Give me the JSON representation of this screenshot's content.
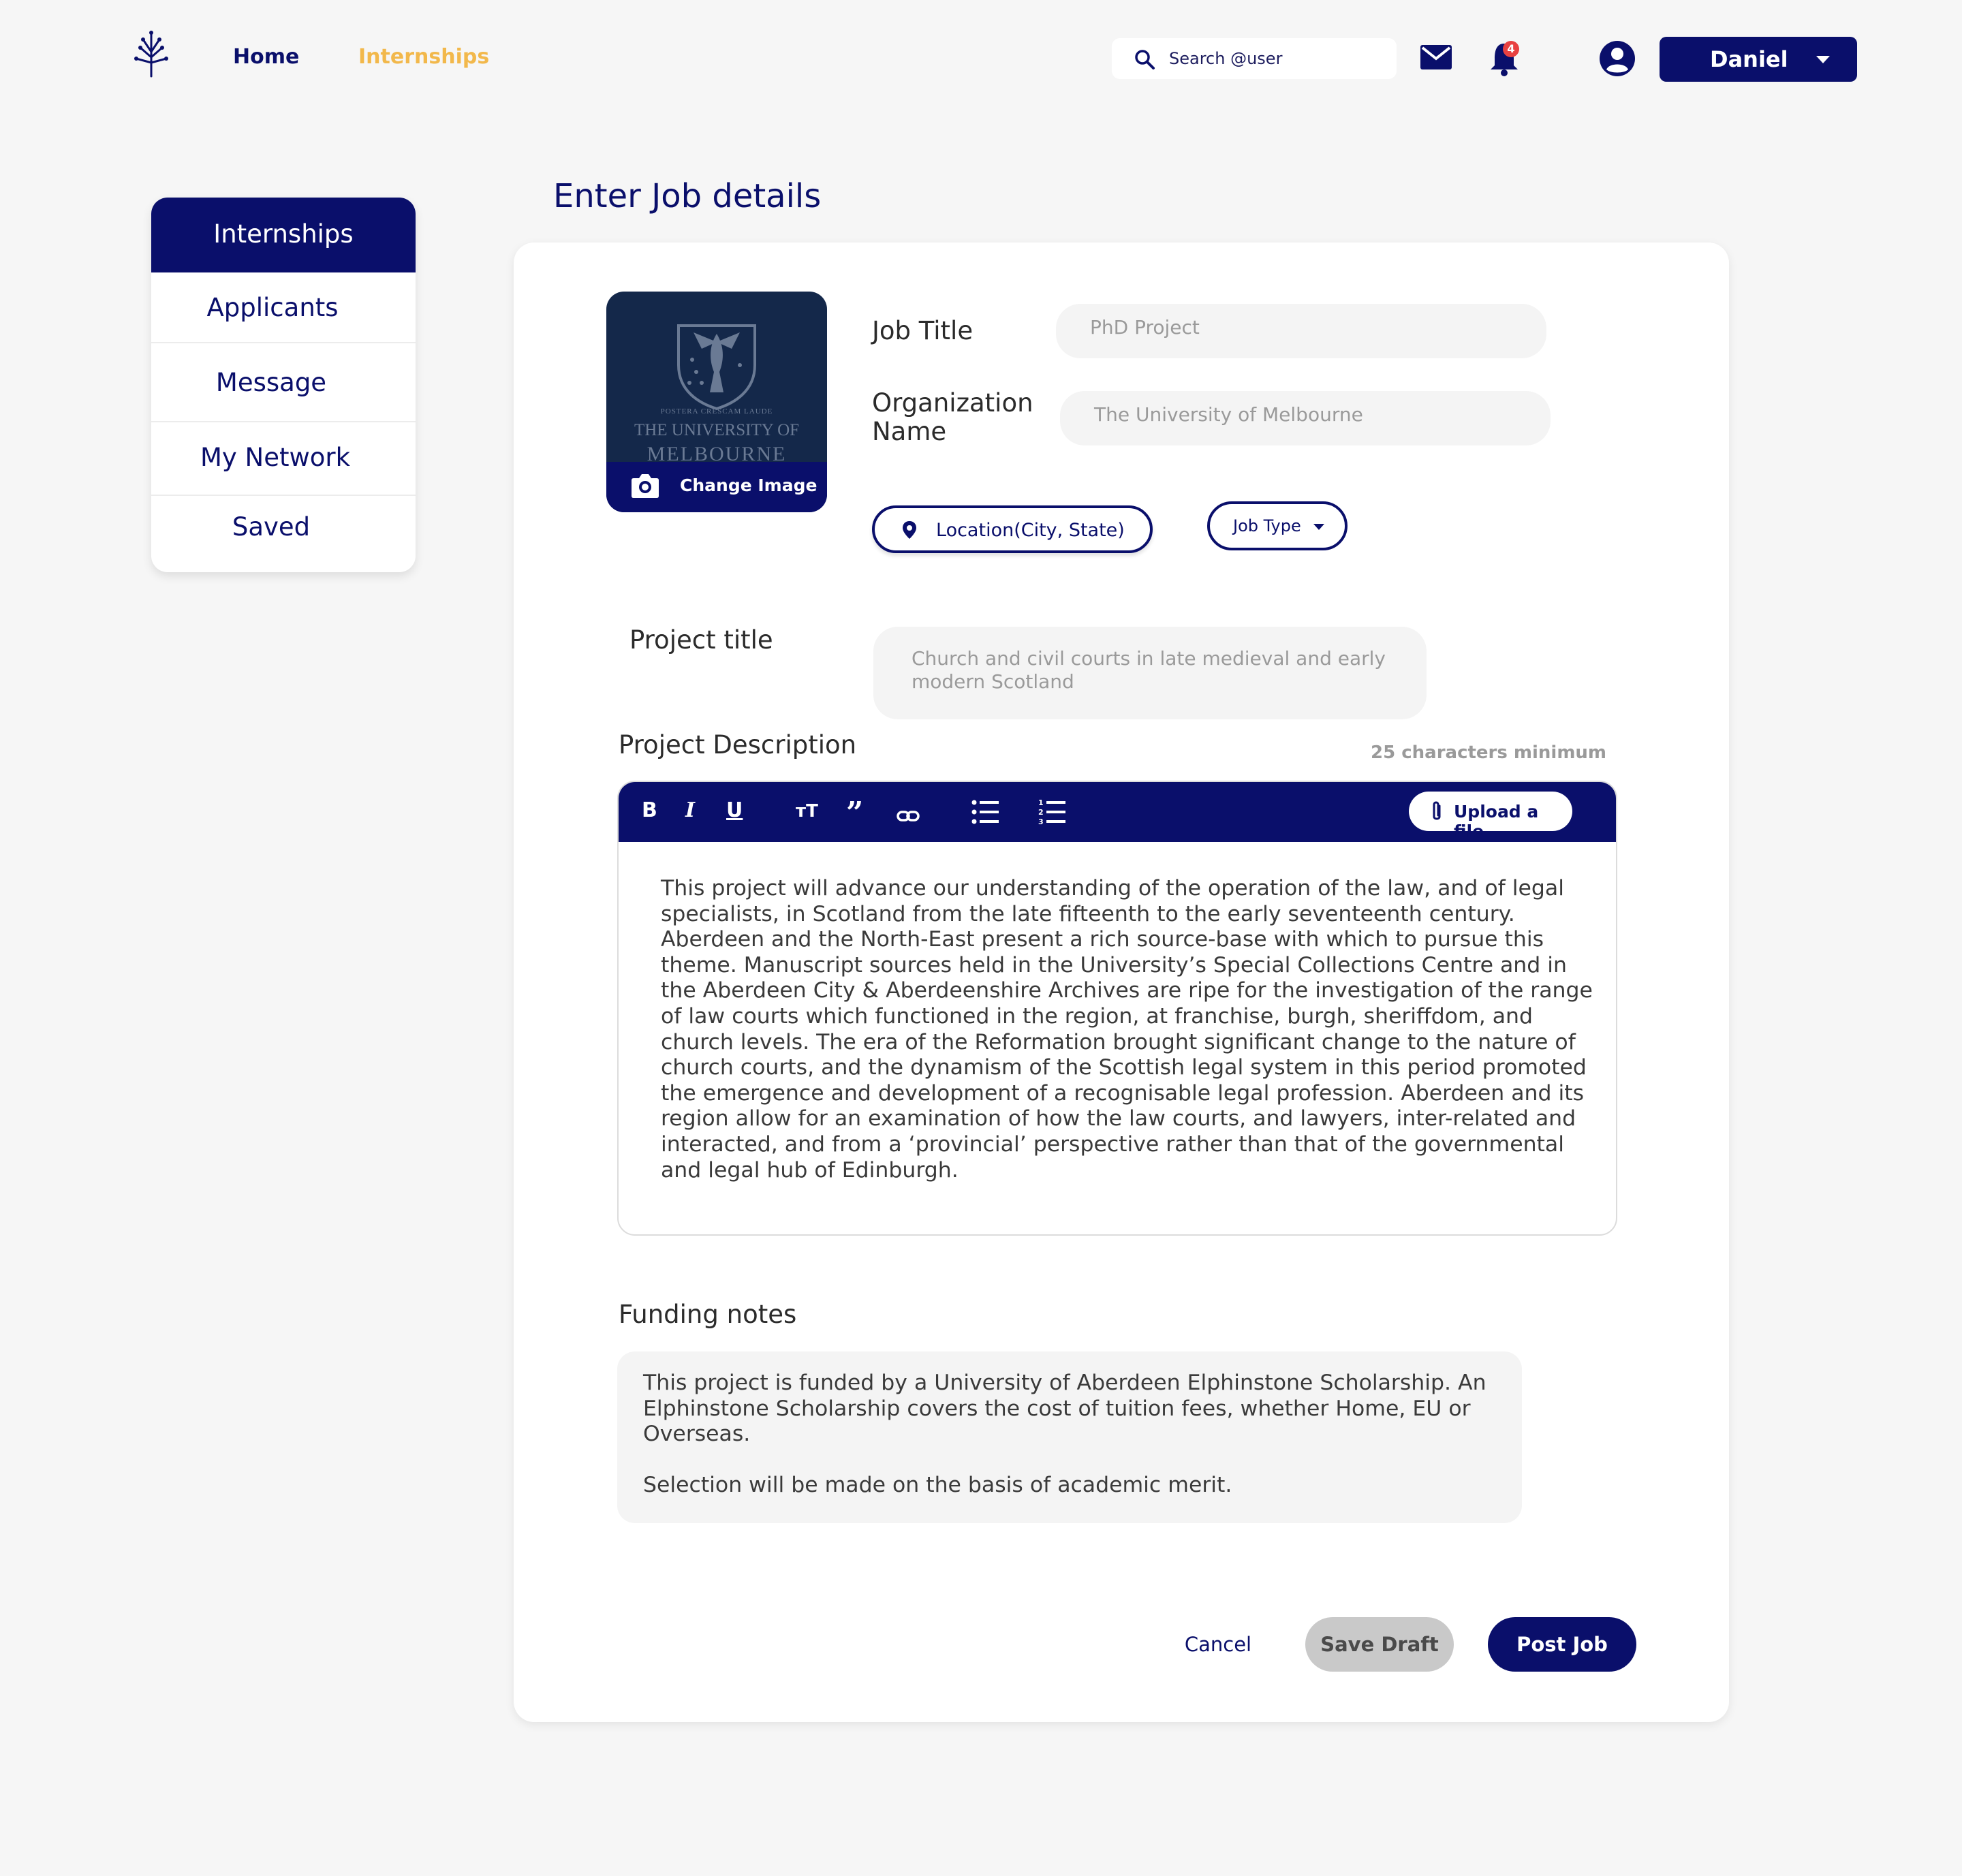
{
  "nav": {
    "home": "Home",
    "internships": "Internships",
    "search_placeholder": "Search @user",
    "notification_count": "4",
    "user_name": "Daniel"
  },
  "sidebar": {
    "items": [
      {
        "label": "Internships",
        "active": true
      },
      {
        "label": "Applicants"
      },
      {
        "label": "Message"
      },
      {
        "label": "My Network"
      },
      {
        "label": "Saved"
      }
    ]
  },
  "page": {
    "heading": "Enter Job details"
  },
  "form": {
    "image": {
      "university_line1": "THE UNIVERSITY OF",
      "university_line2": "MELBOURNE",
      "motto": "POSTERA CRESCAM LAUDE",
      "change_image": "Change Image"
    },
    "job_title_label": "Job Title",
    "job_title_value": "PhD Project",
    "org_label_1": "Organization",
    "org_label_2": "Name",
    "org_value": "The University of Melbourne",
    "location_label": "Location(City, State)",
    "job_type_label": "Job Type",
    "project_title_label": "Project title",
    "project_title_line1": "Church and civil courts in late medieval  and early",
    "project_title_line2": "modern Scotland",
    "project_desc_label": "Project Description",
    "min_chars": "25 characters minimum",
    "upload_label": "Upload a file",
    "description": "This project will advance our understanding of the operation of the law, and of legal specialists, in Scotland from the late fifteenth to the early seventeenth century. Aberdeen and the North-East present a rich source-base with which to pursue this theme. Manuscript sources held in the University’s Special Collections Centre and in the Aberdeen City & Aberdeenshire Archives are ripe for the investigation of the range of law courts which functioned in the region, at franchise, burgh, sheriffdom, and church levels. The era of the Reformation brought significant change to the nature of church courts, and the dynamism of the Scottish legal system in this period promoted the emergence and development of a recognisable legal profession. Aberdeen and its region allow for an examination of how the law courts, and lawyers, inter-related and interacted, and from a ‘provincial’ perspective rather than that of the governmental and legal hub of Edinburgh.",
    "funding_label": "Funding notes",
    "funding_p1": "This project is funded by a University of Aberdeen Elphinstone Scholarship. An Elphinstone Scholarship covers the cost of tuition fees, whether Home, EU or Overseas.",
    "funding_p2": "Selection will be made on the basis of academic merit."
  },
  "actions": {
    "cancel": "Cancel",
    "save_draft": "Save Draft",
    "post_job": "Post Job"
  },
  "colors": {
    "primary": "#0a0f6b",
    "accent": "#f2b84b",
    "badge": "#e84141",
    "draft_button": "#c9c9c9"
  }
}
